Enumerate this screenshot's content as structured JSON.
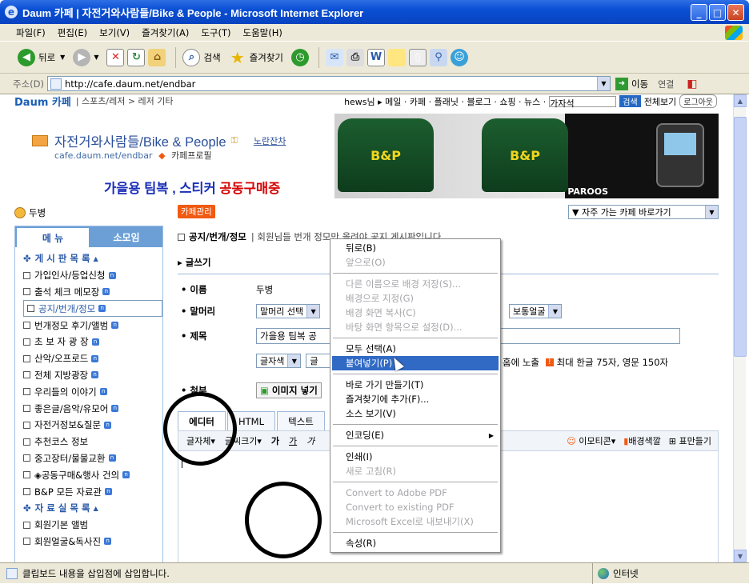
{
  "window": {
    "title": "Daum 카페 | 자전거와사람들/Bike & People - Microsoft Internet Explorer",
    "min": "_",
    "max": "□",
    "close": "✕"
  },
  "menubar": [
    "파일(F)",
    "편집(E)",
    "보기(V)",
    "즐겨찾기(A)",
    "도구(T)",
    "도움말(H)"
  ],
  "toolbar": {
    "back": "뒤로",
    "search": "검색",
    "favorites": "즐겨찾기"
  },
  "address": {
    "label": "주소(D)",
    "url": "http://cafe.daum.net/endbar",
    "go": "이동",
    "links": "연결"
  },
  "topnav": {
    "logo": "Daum 카페",
    "path": "| 스포츠/레저 > 레저 기타",
    "news": "hews님 ▸ 메일 · 카페 · 플래닛 · 블로그 · 쇼핑 · 뉴스 ·",
    "search_placeholder": "가자석",
    "search_btn": "검색",
    "all_view": "전체보기",
    "logout": "로그아웃"
  },
  "cafe": {
    "name": "자전거와사람들/Bike & People",
    "level_tag": "노란잔차",
    "url": "cafe.daum.net/endbar",
    "profile": "카페프로필"
  },
  "promo": {
    "part1": "가을용 팀복 , 스티커",
    "part2": "공동구매중"
  },
  "banner": {
    "jersey_text": "B&P",
    "brand": "PAROOS"
  },
  "user": "두병",
  "manage_btn": "카페관리",
  "goto_select": "▼ 자주 가는 카페 바로가기",
  "sidebar": {
    "tabs": [
      "메 뉴",
      "소모임"
    ],
    "items": [
      {
        "label": "게 시 판 목 록",
        "type": "head"
      },
      {
        "label": "가입인사/등업신청",
        "new": true
      },
      {
        "label": "출석 체크 메모장",
        "new": true
      },
      {
        "label": "공지/번개/정모",
        "new": true,
        "selected": true
      },
      {
        "label": "번개정모 후기/앨범",
        "new": true
      },
      {
        "label": "초 보 자 광 장",
        "new": true
      },
      {
        "label": "산악/오프로드",
        "new": true
      },
      {
        "label": "전체 지방광장",
        "new": true
      },
      {
        "label": "우리들의 이야기",
        "new": true
      },
      {
        "label": "좋은글/음악/유모어",
        "new": true
      },
      {
        "label": "자전거정보&질문",
        "new": true
      },
      {
        "label": "추천코스 정보",
        "new": false
      },
      {
        "label": "중고장터/물물교환",
        "new": true
      },
      {
        "label": "◈공동구매&행사 건의",
        "new": true
      },
      {
        "label": "B&P 모든 자료관",
        "new": true
      },
      {
        "label": "자 료 실 목 록",
        "type": "head"
      },
      {
        "label": "회원기본 앨범",
        "new": false
      },
      {
        "label": "회원얼굴&독사진",
        "new": true
      }
    ]
  },
  "main": {
    "board": "공지/번개/정모",
    "board_desc": "| 회원님들 번개 정모만 올려야 공지 게시판입니다",
    "write": "글쓰기",
    "name_label": "이름",
    "name_value": "두병",
    "head_label": "말머리",
    "head_select": "말머리 선택",
    "face_select": "보통얼굴",
    "subject_label": "제목",
    "subject_value": "가을용 팀복 공",
    "color_select": "글자색",
    "char_select": "글",
    "notice_text": "홈에 노출",
    "limit_text": "최대 한글 75자, 영문 150자",
    "attach_label": "첨부",
    "image_btn": "이미지 넣기",
    "editor_tabs": [
      "에디터",
      "HTML",
      "텍스트"
    ],
    "editor_toolbar": {
      "font": "글자체",
      "size": "글씨크기",
      "bold": "가",
      "underline": "가",
      "italic": "가",
      "emoticon": "이모티콘",
      "bgcolor": "배경색깔",
      "table": "표만들기"
    }
  },
  "context_menu": [
    {
      "label": "뒤로(B)",
      "enabled": true
    },
    {
      "label": "앞으로(O)",
      "enabled": false
    },
    {
      "type": "divider"
    },
    {
      "label": "다른 이름으로 배경 저장(S)...",
      "enabled": false
    },
    {
      "label": "배경으로 지정(G)",
      "enabled": false
    },
    {
      "label": "배경 화면 복사(C)",
      "enabled": false
    },
    {
      "label": "바탕 화면 항목으로 설정(D)...",
      "enabled": false
    },
    {
      "type": "divider"
    },
    {
      "label": "모두 선택(A)",
      "enabled": true
    },
    {
      "label": "붙여넣기(P)",
      "enabled": true,
      "highlighted": true
    },
    {
      "type": "divider"
    },
    {
      "label": "바로 가기 만들기(T)",
      "enabled": true
    },
    {
      "label": "즐겨찾기에 추가(F)...",
      "enabled": true
    },
    {
      "label": "소스 보기(V)",
      "enabled": true
    },
    {
      "type": "divider"
    },
    {
      "label": "인코딩(E)",
      "enabled": true,
      "submenu": true
    },
    {
      "type": "divider"
    },
    {
      "label": "인쇄(I)",
      "enabled": true
    },
    {
      "label": "새로 고침(R)",
      "enabled": false
    },
    {
      "type": "divider"
    },
    {
      "label": "Convert to Adobe PDF",
      "enabled": false
    },
    {
      "label": "Convert to existing PDF",
      "enabled": false
    },
    {
      "label": "Microsoft Excel로 내보내기(X)",
      "enabled": false
    },
    {
      "type": "divider"
    },
    {
      "label": "속성(R)",
      "enabled": true
    }
  ],
  "status": {
    "text": "클립보드 내용을 삽입점에 삽입합니다.",
    "zone": "인터넷"
  }
}
